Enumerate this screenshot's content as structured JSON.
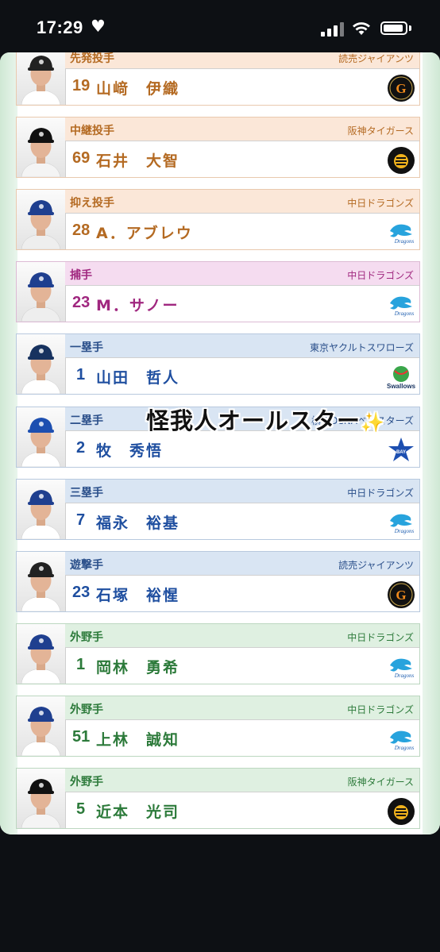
{
  "status_bar": {
    "time": "17:29",
    "heart": "♥"
  },
  "overlay": {
    "text": "怪我人オールスター",
    "emoji": "✨"
  },
  "players": [
    {
      "role": "先発投手",
      "team": "読売ジャイアンツ",
      "number": "19",
      "name": "山﨑　伊織",
      "logo": "giants-logo",
      "group": "pitcher",
      "cap": "#222222",
      "jersey": "#ffffff"
    },
    {
      "role": "中継投手",
      "team": "阪神タイガース",
      "number": "69",
      "name": "石井　大智",
      "logo": "tigers-logo",
      "group": "pitcher",
      "cap": "#111111",
      "jersey": "#f4f4f4"
    },
    {
      "role": "抑え投手",
      "team": "中日ドラゴンズ",
      "number": "28",
      "name": "A．アブレウ",
      "logo": "dragons-logo",
      "group": "pitcher",
      "cap": "#1f3f8f",
      "jersey": "#eeeeee"
    },
    {
      "role": "捕手",
      "team": "中日ドラゴンズ",
      "number": "23",
      "name": "M．サノー",
      "logo": "dragons-logo",
      "group": "catcher",
      "cap": "#1f3f8f",
      "jersey": "#eeeeee"
    },
    {
      "role": "一塁手",
      "team": "東京ヤクルトスワローズ",
      "number": "1",
      "name": "山田　哲人",
      "logo": "swallows-logo",
      "group": "infield",
      "cap": "#17325f",
      "jersey": "#ffffff"
    },
    {
      "role": "二塁手",
      "team": "横浜DeNAベイスターズ",
      "number": "2",
      "name": "牧　秀悟",
      "logo": "baystars-logo",
      "group": "infield",
      "cap": "#1d4fb0",
      "jersey": "#ffffff"
    },
    {
      "role": "三塁手",
      "team": "中日ドラゴンズ",
      "number": "7",
      "name": "福永　裕基",
      "logo": "dragons-logo",
      "group": "infield",
      "cap": "#1f3f8f",
      "jersey": "#ffffff"
    },
    {
      "role": "遊撃手",
      "team": "読売ジャイアンツ",
      "number": "23",
      "name": "石塚　裕惺",
      "logo": "giants-logo",
      "group": "infield",
      "cap": "#222222",
      "jersey": "#ffffff"
    },
    {
      "role": "外野手",
      "team": "中日ドラゴンズ",
      "number": "1",
      "name": "岡林　勇希",
      "logo": "dragons-logo",
      "group": "outfield",
      "cap": "#1f3f8f",
      "jersey": "#ffffff"
    },
    {
      "role": "外野手",
      "team": "中日ドラゴンズ",
      "number": "51",
      "name": "上林　誠知",
      "logo": "dragons-logo",
      "group": "outfield",
      "cap": "#1f3f8f",
      "jersey": "#ffffff"
    },
    {
      "role": "外野手",
      "team": "阪神タイガース",
      "number": "5",
      "name": "近本　光司",
      "logo": "tigers-logo",
      "group": "outfield",
      "cap": "#111111",
      "jersey": "#f4f4f4"
    }
  ]
}
